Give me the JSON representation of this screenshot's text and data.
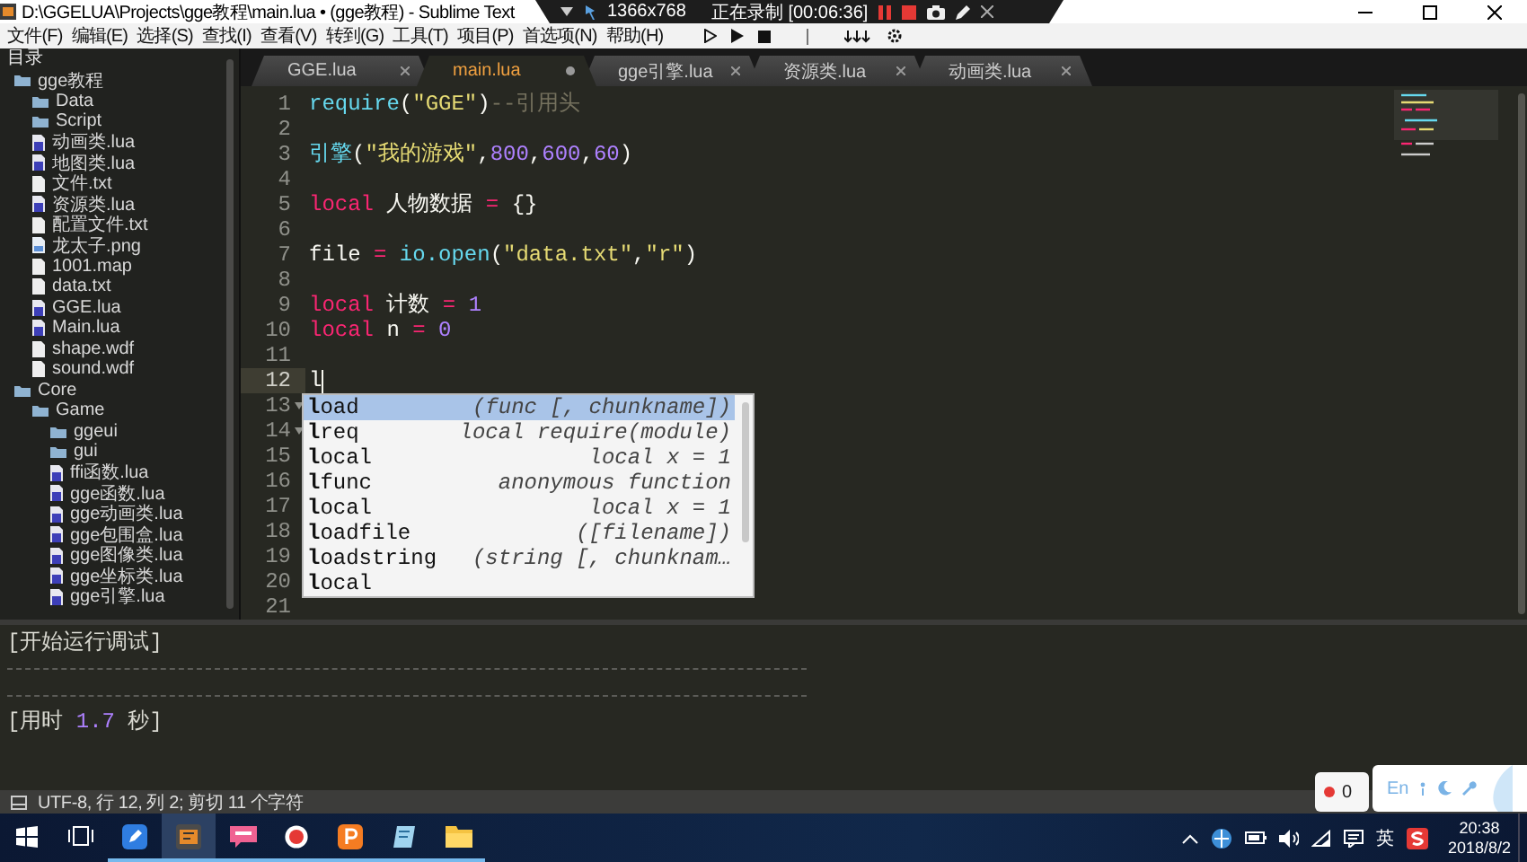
{
  "window": {
    "title": "D:\\GGELUA\\Projects\\gge教程\\main.lua • (gge教程) - Sublime Text"
  },
  "recorder": {
    "resolution": "1366x768",
    "status": "正在录制 [00:06:36]"
  },
  "menu": [
    "文件(F)",
    "编辑(E)",
    "选择(S)",
    "查找(I)",
    "查看(V)",
    "转到(G)",
    "工具(T)",
    "项目(P)",
    "首选项(N)",
    "帮助(H)"
  ],
  "sidebar": {
    "title": "目录",
    "tree": [
      {
        "label": "gge教程",
        "kind": "folder",
        "children": [
          {
            "label": "Data",
            "kind": "folder"
          },
          {
            "label": "Script",
            "kind": "folder"
          },
          {
            "label": "动画类.lua",
            "kind": "lua"
          },
          {
            "label": "地图类.lua",
            "kind": "lua"
          },
          {
            "label": "文件.txt",
            "kind": "text"
          },
          {
            "label": "资源类.lua",
            "kind": "lua"
          },
          {
            "label": "配置文件.txt",
            "kind": "text"
          },
          {
            "label": "龙太子.png",
            "kind": "image"
          },
          {
            "label": "1001.map",
            "kind": "text"
          },
          {
            "label": "data.txt",
            "kind": "text"
          },
          {
            "label": "GGE.lua",
            "kind": "lua"
          },
          {
            "label": "Main.lua",
            "kind": "lua"
          },
          {
            "label": "shape.wdf",
            "kind": "text"
          },
          {
            "label": "sound.wdf",
            "kind": "text"
          }
        ]
      },
      {
        "label": "Core",
        "kind": "folder",
        "children": [
          {
            "label": "Game",
            "kind": "folder",
            "children": [
              {
                "label": "ggeui",
                "kind": "folder"
              },
              {
                "label": "gui",
                "kind": "folder"
              },
              {
                "label": "ffi函数.lua",
                "kind": "lua"
              },
              {
                "label": "gge函数.lua",
                "kind": "lua"
              },
              {
                "label": "gge动画类.lua",
                "kind": "lua"
              },
              {
                "label": "gge包围盒.lua",
                "kind": "lua"
              },
              {
                "label": "gge图像类.lua",
                "kind": "lua"
              },
              {
                "label": "gge坐标类.lua",
                "kind": "lua"
              },
              {
                "label": "gge引擎.lua",
                "kind": "lua"
              }
            ]
          }
        ]
      }
    ]
  },
  "tabs": [
    {
      "label": "GGE.lua",
      "selected": false,
      "dirty": false
    },
    {
      "label": "main.lua",
      "selected": true,
      "dirty": true
    },
    {
      "label": "gge引擎.lua",
      "selected": false,
      "dirty": false
    },
    {
      "label": "资源类.lua",
      "selected": false,
      "dirty": false
    },
    {
      "label": "动画类.lua",
      "selected": false,
      "dirty": false
    }
  ],
  "editor": {
    "lines": [
      {
        "number": "1",
        "current": false,
        "foldable": false,
        "tokens": [
          {
            "kind": "function",
            "text": "require"
          },
          {
            "kind": "plain",
            "text": "("
          },
          {
            "kind": "string",
            "text": "\"GGE\""
          },
          {
            "kind": "plain",
            "text": ")"
          },
          {
            "kind": "comment",
            "text": "--引用头"
          }
        ]
      },
      {
        "number": "2",
        "current": false,
        "foldable": false
      },
      {
        "number": "3",
        "current": false,
        "foldable": false,
        "tokens": [
          {
            "kind": "function",
            "text": "引擎"
          },
          {
            "kind": "plain",
            "text": "("
          },
          {
            "kind": "string",
            "text": "\"我的游戏\""
          },
          {
            "kind": "plain",
            "text": ","
          },
          {
            "kind": "number",
            "text": "800"
          },
          {
            "kind": "plain",
            "text": ","
          },
          {
            "kind": "number",
            "text": "600"
          },
          {
            "kind": "plain",
            "text": ","
          },
          {
            "kind": "number",
            "text": "60"
          },
          {
            "kind": "plain",
            "text": ")"
          }
        ]
      },
      {
        "number": "4",
        "current": false,
        "foldable": false
      },
      {
        "number": "5",
        "current": false,
        "foldable": false,
        "tokens": [
          {
            "kind": "keyword",
            "text": "local"
          },
          {
            "kind": "plain",
            "text": " 人物数据 "
          },
          {
            "kind": "keyword",
            "text": "="
          },
          {
            "kind": "plain",
            "text": " {}"
          }
        ]
      },
      {
        "number": "6",
        "current": false,
        "foldable": false
      },
      {
        "number": "7",
        "current": false,
        "foldable": false,
        "tokens": [
          {
            "kind": "plain",
            "text": "file "
          },
          {
            "kind": "keyword",
            "text": "="
          },
          {
            "kind": "function",
            "text": " io.open"
          },
          {
            "kind": "plain",
            "text": "("
          },
          {
            "kind": "string",
            "text": "\"data.txt\""
          },
          {
            "kind": "plain",
            "text": ","
          },
          {
            "kind": "string",
            "text": "\"r\""
          },
          {
            "kind": "plain",
            "text": ")"
          }
        ]
      },
      {
        "number": "8",
        "current": false,
        "foldable": false
      },
      {
        "number": "9",
        "current": false,
        "foldable": false,
        "tokens": [
          {
            "kind": "keyword",
            "text": "local"
          },
          {
            "kind": "plain",
            "text": " 计数 "
          },
          {
            "kind": "keyword",
            "text": "="
          },
          {
            "kind": "number",
            "text": " 1"
          }
        ]
      },
      {
        "number": "10",
        "current": false,
        "foldable": false,
        "tokens": [
          {
            "kind": "keyword",
            "text": "local"
          },
          {
            "kind": "plain",
            "text": " n "
          },
          {
            "kind": "keyword",
            "text": "="
          },
          {
            "kind": "number",
            "text": " 0"
          }
        ]
      },
      {
        "number": "11",
        "current": false,
        "foldable": false
      },
      {
        "number": "12",
        "current": true,
        "foldable": false,
        "tokens": [
          {
            "kind": "plain",
            "text": "l"
          }
        ]
      },
      {
        "number": "13",
        "current": false,
        "foldable": true
      },
      {
        "number": "14",
        "current": false,
        "foldable": true
      },
      {
        "number": "15",
        "current": false,
        "foldable": false
      },
      {
        "number": "16",
        "current": false,
        "foldable": false
      },
      {
        "number": "17",
        "current": false,
        "foldable": false
      },
      {
        "number": "18",
        "current": false,
        "foldable": false
      },
      {
        "number": "19",
        "current": false,
        "foldable": false
      },
      {
        "number": "20",
        "current": false,
        "foldable": false
      },
      {
        "number": "21",
        "current": false,
        "foldable": false
      }
    ],
    "autocomplete": [
      {
        "trigger": "**l**oad",
        "hint": "(func [, chunkname])",
        "selected": true
      },
      {
        "trigger": "**l**req",
        "hint": "local require(module)",
        "selected": false
      },
      {
        "trigger": "**l**ocal",
        "hint": "local x = 1",
        "selected": false
      },
      {
        "trigger": "**l**func",
        "hint": "anonymous function",
        "selected": false
      },
      {
        "trigger": "**l**ocal",
        "hint": "local x = 1",
        "selected": false
      },
      {
        "trigger": "**l**oadfile",
        "hint": "([filename])",
        "selected": false
      },
      {
        "trigger": "**l**oadstring",
        "hint": "(string [, chunknam…",
        "selected": false
      },
      {
        "trigger": "**l**ocal",
        "selected": false
      }
    ]
  },
  "console": [
    {
      "kind": "text",
      "parts": [
        {
          "kind": "plain",
          "text": "[开始运行调试]"
        }
      ]
    },
    {
      "kind": "rule"
    },
    {
      "kind": "rule"
    },
    {
      "kind": "text",
      "parts": [
        {
          "kind": "plain",
          "text": "[用时 "
        },
        {
          "kind": "number",
          "text": "1.7"
        },
        {
          "kind": "plain",
          "text": " 秒]"
        }
      ]
    }
  ],
  "status_bar": {
    "text": "UTF-8, 行 12, 列 2; 剪切 11 个字符"
  },
  "overlay": {
    "record_count": "0",
    "language": "En"
  },
  "taskbar": {
    "apps": [
      {
        "kind": "start",
        "running": false,
        "selected": false
      },
      {
        "kind": "task-view",
        "running": false,
        "selected": false
      },
      {
        "kind": "pen",
        "running": true,
        "selected": false
      },
      {
        "kind": "editor",
        "running": true,
        "selected": true
      },
      {
        "kind": "chat",
        "running": true,
        "selected": false
      },
      {
        "kind": "record",
        "running": true,
        "selected": false
      },
      {
        "kind": "slides",
        "running": true,
        "selected": false
      },
      {
        "kind": "notepad",
        "running": true,
        "selected": false
      },
      {
        "kind": "folder",
        "running": true,
        "selected": false
      }
    ],
    "input_language": "英",
    "time": "20:38",
    "date": "2018/8/2"
  }
}
